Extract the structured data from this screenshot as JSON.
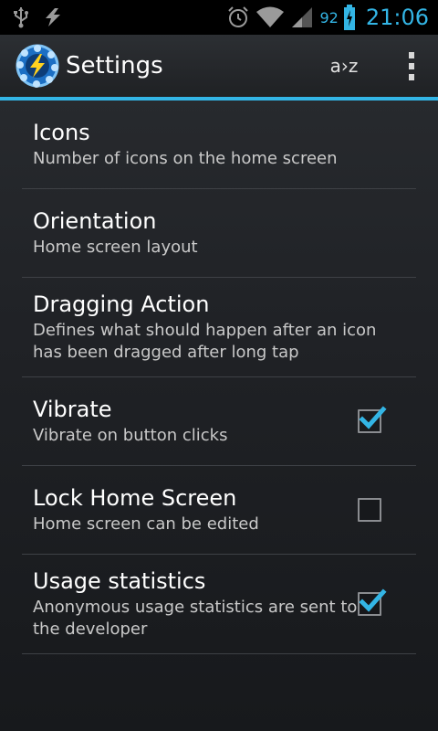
{
  "status_bar": {
    "battery_percent": "92",
    "time": "21:06"
  },
  "action_bar": {
    "title": "Settings",
    "sort_label": "a›z"
  },
  "preferences": [
    {
      "title": "Icons",
      "summary": "Number of icons on the home screen",
      "has_checkbox": false
    },
    {
      "title": "Orientation",
      "summary": "Home screen layout",
      "has_checkbox": false
    },
    {
      "title": "Dragging Action",
      "summary": "Defines what should happen after an icon has been dragged after long tap",
      "has_checkbox": false
    },
    {
      "title": "Vibrate",
      "summary": "Vibrate on button clicks",
      "has_checkbox": true,
      "checked": true
    },
    {
      "title": "Lock Home Screen",
      "summary": "Home screen can be edited",
      "has_checkbox": true,
      "checked": false
    },
    {
      "title": "Usage statistics",
      "summary": "Anonymous usage statistics are sent to the developer",
      "has_checkbox": true,
      "checked": true
    }
  ],
  "colors": {
    "accent": "#33b5e5",
    "background": "#202226",
    "divider": "#3e4146"
  }
}
